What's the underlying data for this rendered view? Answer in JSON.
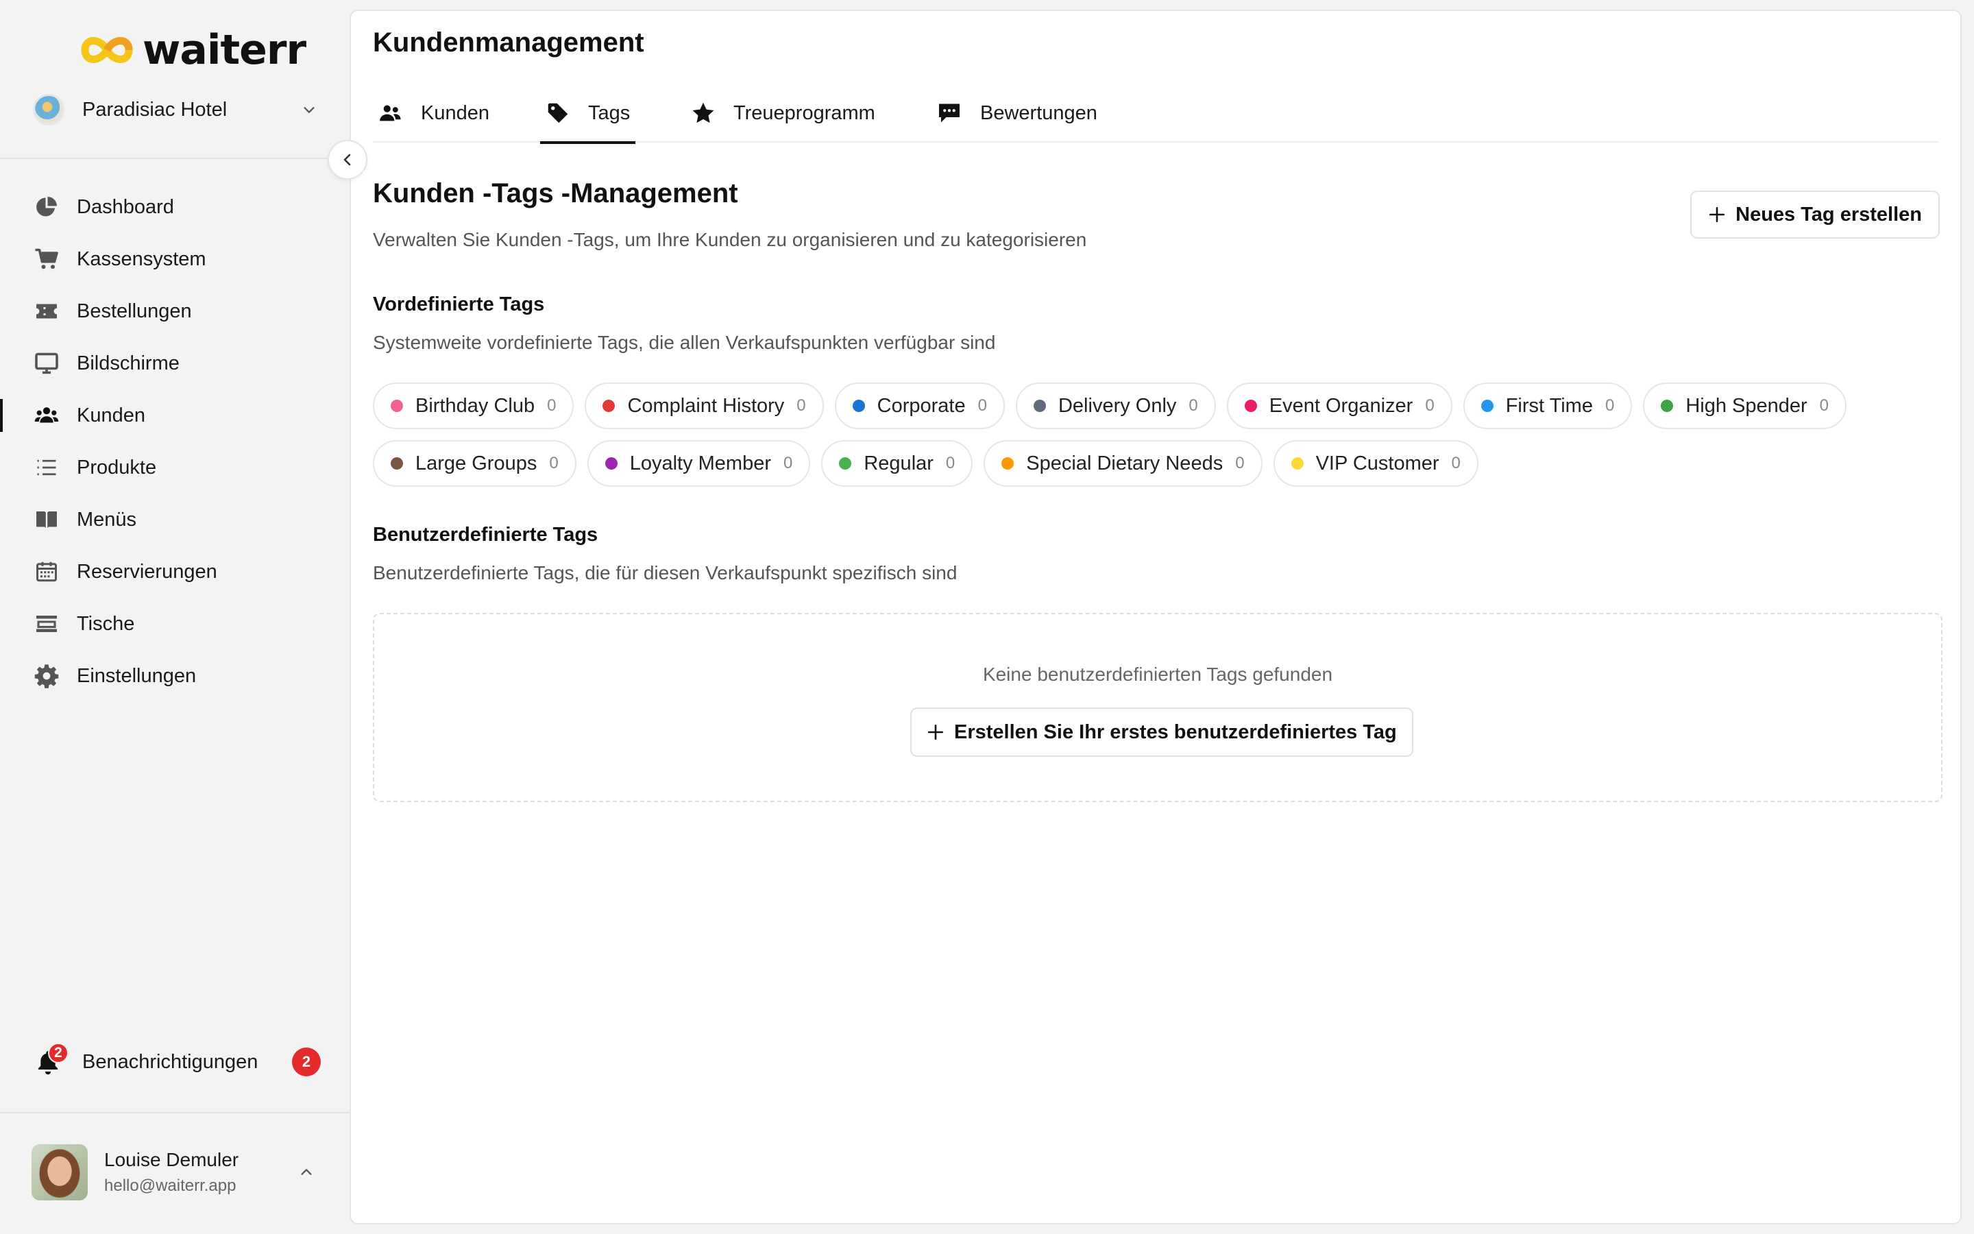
{
  "brand": {
    "name": "waiterr",
    "logo_colors": [
      "#f5c518",
      "#f0a020"
    ]
  },
  "hotel": {
    "name": "Paradisiac Hotel"
  },
  "nav": [
    {
      "label": "Dashboard",
      "icon": "pie-chart-icon"
    },
    {
      "label": "Kassensystem",
      "icon": "cart-icon"
    },
    {
      "label": "Bestellungen",
      "icon": "ticket-icon"
    },
    {
      "label": "Bildschirme",
      "icon": "monitor-icon"
    },
    {
      "label": "Kunden",
      "icon": "users-icon",
      "active": true
    },
    {
      "label": "Produkte",
      "icon": "list-icon"
    },
    {
      "label": "Menüs",
      "icon": "book-icon"
    },
    {
      "label": "Reservierungen",
      "icon": "calendar-icon"
    },
    {
      "label": "Tische",
      "icon": "table-icon"
    },
    {
      "label": "Einstellungen",
      "icon": "gear-icon"
    }
  ],
  "notifications": {
    "label": "Benachrichtigungen",
    "count": "2",
    "bell_badge": "2"
  },
  "user": {
    "name": "Louise Demuler",
    "email": "hello@waiterr.app"
  },
  "page": {
    "title": "Kundenmanagement",
    "tabs": [
      {
        "label": "Kunden",
        "icon": "users-icon"
      },
      {
        "label": "Tags",
        "icon": "tag-icon",
        "active": true
      },
      {
        "label": "Treueprogramm",
        "icon": "star-icon"
      },
      {
        "label": "Bewertungen",
        "icon": "chat-icon"
      }
    ]
  },
  "section": {
    "title": "Kunden -Tags -Management",
    "subtitle": "Verwalten Sie Kunden -Tags, um Ihre Kunden zu organisieren und zu kategorisieren",
    "new_button": "Neues Tag erstellen"
  },
  "predefined": {
    "title": "Vordefinierte Tags",
    "subtitle": "Systemweite vordefinierte Tags, die allen Verkaufspunkten verfügbar sind",
    "tags": [
      {
        "name": "Birthday Club",
        "count": "0",
        "color": "#f06292"
      },
      {
        "name": "Complaint History",
        "count": "0",
        "color": "#e53935"
      },
      {
        "name": "Corporate",
        "count": "0",
        "color": "#1976d2"
      },
      {
        "name": "Delivery Only",
        "count": "0",
        "color": "#5f6b7a"
      },
      {
        "name": "Event Organizer",
        "count": "0",
        "color": "#e91e63"
      },
      {
        "name": "First Time",
        "count": "0",
        "color": "#2196f3"
      },
      {
        "name": "High Spender",
        "count": "0",
        "color": "#43a047"
      },
      {
        "name": "Large Groups",
        "count": "0",
        "color": "#795548"
      },
      {
        "name": "Loyalty Member",
        "count": "0",
        "color": "#9c27b0"
      },
      {
        "name": "Regular",
        "count": "0",
        "color": "#4caf50"
      },
      {
        "name": "Special Dietary Needs",
        "count": "0",
        "color": "#ff9800"
      },
      {
        "name": "VIP Customer",
        "count": "0",
        "color": "#fdd835"
      }
    ]
  },
  "custom": {
    "title": "Benutzerdefinierte Tags",
    "subtitle": "Benutzerdefinierte Tags, die für diesen Verkaufspunkt spezifisch sind",
    "empty_message": "Keine benutzerdefinierten Tags gefunden",
    "create_button": "Erstellen Sie Ihr erstes benutzerdefiniertes Tag"
  }
}
